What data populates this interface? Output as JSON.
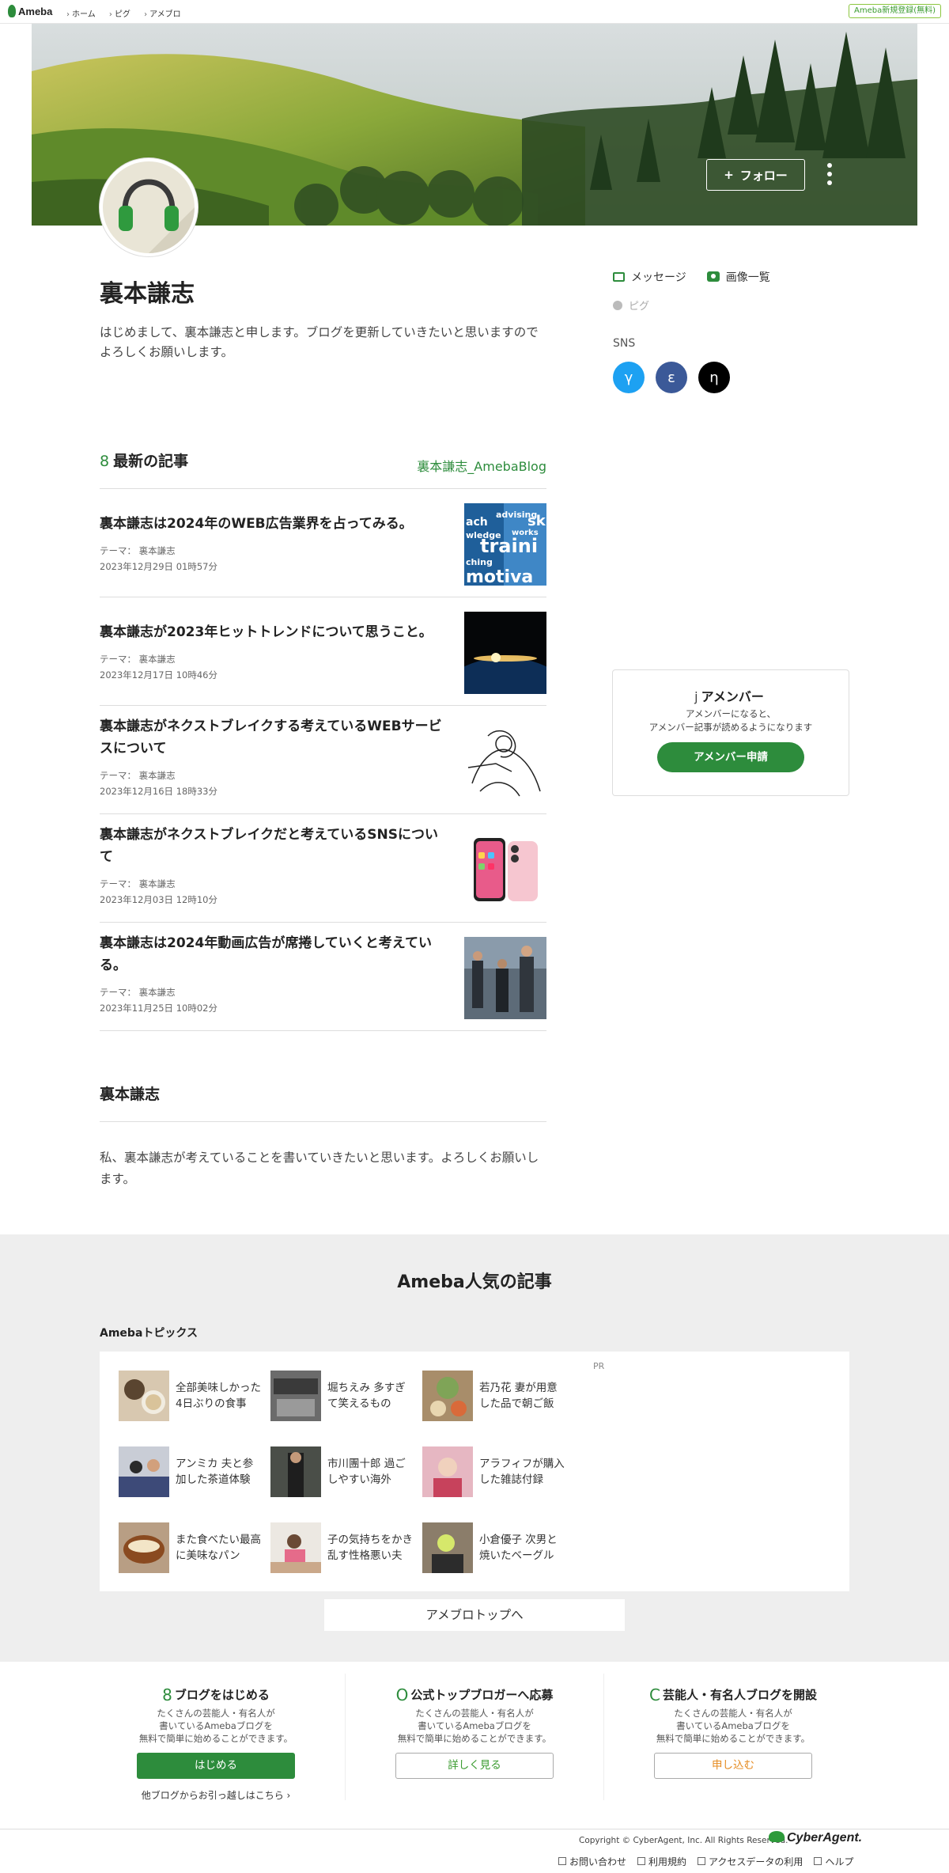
{
  "header": {
    "logo": "Ameba",
    "breadcrumbs": [
      "ホーム",
      "ピグ",
      "アメブロ"
    ],
    "signup": "Ameba新規登録(無料)"
  },
  "hero": {
    "follow_label": "フォロー",
    "follow_icon": "+"
  },
  "profile": {
    "name": "裏本謙志",
    "bio": "はじめまして、裏本謙志と申します。ブログを更新していきたいと思いますのでよろしくお願いします。",
    "message_label": "メッセージ",
    "images_label": "画像一覧",
    "pigg_label": "ピグ",
    "sns_label": "SNS",
    "sns_icons": [
      {
        "glyph": "γ",
        "color": "#1da1f2"
      },
      {
        "glyph": "ε",
        "color": "#3b5998"
      },
      {
        "glyph": "η",
        "color": "#000000"
      }
    ]
  },
  "latest": {
    "heading_icon": "8",
    "heading": "最新の記事",
    "blog_link": "裏本謙志_AmebaBlog",
    "articles": [
      {
        "title": "裏本謙志は2024年のWEB広告業界を占ってみる。",
        "theme": "テーマ：  裏本謙志",
        "date": "2023年12月29日 01時57分"
      },
      {
        "title": "裏本謙志が2023年ヒットトレンドについて思うこと。",
        "theme": "テーマ：  裏本謙志",
        "date": "2023年12月17日 10時46分"
      },
      {
        "title": "裏本謙志がネクストブレイクする考えているWEBサービスについて",
        "theme": "テーマ：  裏本謙志",
        "date": "2023年12月16日 18時33分"
      },
      {
        "title": "裏本謙志がネクストブレイクだと考えているSNSについて",
        "theme": "テーマ：  裏本謙志",
        "date": "2023年12月03日 12時10分"
      },
      {
        "title": "裏本謙志は2024年動画広告が席捲していくと考えている。",
        "theme": "テーマ：  裏本謙志",
        "date": "2023年11月25日 10時02分"
      }
    ]
  },
  "blog_desc": {
    "heading": "裏本謙志",
    "body": "私、裏本謙志が考えていることを書いていきたいと思います。よろしくお願いします。"
  },
  "member": {
    "icon": "j",
    "title": "アメンバー",
    "line1": "アメンバーになると、",
    "line2": "アメンバー記事が読めるようになります",
    "button": "アメンバー申請"
  },
  "popular": {
    "heading": "Ameba人気の記事",
    "sub": "Amebaトピックス",
    "pr": "PR",
    "topics": [
      {
        "line1": "全部美味しかった",
        "line2": "4日ぶりの食事"
      },
      {
        "line1": "堀ちえみ 多すぎ",
        "line2": "て笑えるもの"
      },
      {
        "line1": "若乃花 妻が用意",
        "line2": "した品で朝ご飯"
      },
      {
        "line1": "アンミカ 夫と参",
        "line2": "加した茶道体験"
      },
      {
        "line1": "市川團十郎 過ご",
        "line2": "しやすい海外"
      },
      {
        "line1": "アラフィフが購入",
        "line2": "した雑誌付録"
      },
      {
        "line1": "また食べたい最高",
        "line2": "に美味なパン"
      },
      {
        "line1": "子の気持ちをかき",
        "line2": "乱す性格悪い夫"
      },
      {
        "line1": "小倉優子 次男と",
        "line2": "焼いたベーグル"
      }
    ],
    "to_top": "アメブロトップへ"
  },
  "promos": [
    {
      "icon": "8",
      "title": "ブログをはじめる",
      "l1": "たくさんの芸能人・有名人が",
      "l2": "書いているAmebaブログを",
      "l3": "無料で簡単に始めることができます。",
      "button": "はじめる",
      "link": "他ブログからお引っ越しはこちら ›"
    },
    {
      "icon": "O",
      "title": "公式トップブロガーへ応募",
      "l1": "たくさんの芸能人・有名人が",
      "l2": "書いているAmebaブログを",
      "l3": "無料で簡単に始めることができます。",
      "button": "詳しく見る"
    },
    {
      "icon": "C",
      "title": "芸能人・有名人ブログを開設",
      "l1": "たくさんの芸能人・有名人が",
      "l2": "書いているAmebaブログを",
      "l3": "無料で簡単に始めることができます。",
      "button": "申し込む"
    }
  ],
  "footer": {
    "copyright": "Copyright © CyberAgent, Inc. All Rights Reserved.",
    "company_logo": "CyberAgent.",
    "links": [
      "お問い合わせ",
      "利用規約",
      "アクセスデータの利用",
      "ヘルプ"
    ]
  }
}
